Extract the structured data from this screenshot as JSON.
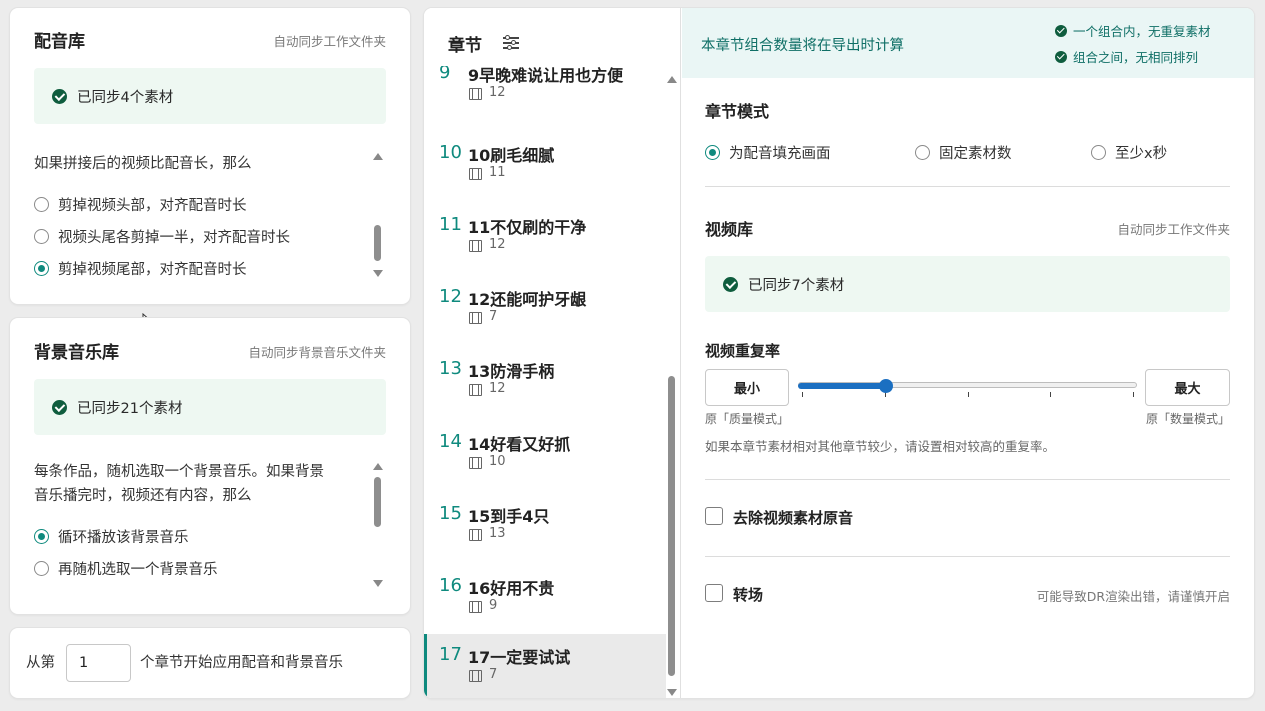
{
  "voice_lib": {
    "title": "配音库",
    "hint": "自动同步工作文件夹",
    "sync_status": "已同步4个素材",
    "question": "如果拼接后的视频比配音长，那么",
    "options": [
      {
        "label": "剪掉视频头部，对齐配音时长",
        "selected": false
      },
      {
        "label": "视频头尾各剪掉一半，对齐配音时长",
        "selected": false
      },
      {
        "label": "剪掉视频尾部，对齐配音时长",
        "selected": true
      }
    ]
  },
  "bgm_lib": {
    "title": "背景音乐库",
    "hint": "自动同步背景音乐文件夹",
    "sync_status": "已同步21个素材",
    "question_line1": "每条作品，随机选取一个背景音乐。如果背景",
    "question_line2": "音乐播完时，视频还有内容，那么",
    "options": [
      {
        "label": "循环播放该背景音乐",
        "selected": true
      },
      {
        "label": "再随机选取一个背景音乐",
        "selected": false
      }
    ]
  },
  "start_chapter": {
    "prefix": "从第",
    "value": "1",
    "suffix": "个章节开始应用配音和背景音乐"
  },
  "chapters": {
    "title": "章节",
    "partial_item": {
      "num": "9",
      "title": "9早晚难说让用也方便",
      "count": "12"
    },
    "items": [
      {
        "num": "10",
        "title": "10刷毛细腻",
        "count": "11"
      },
      {
        "num": "11",
        "title": "11不仅刷的干净",
        "count": "12"
      },
      {
        "num": "12",
        "title": "12还能呵护牙龈",
        "count": "7"
      },
      {
        "num": "13",
        "title": "13防滑手柄",
        "count": "12"
      },
      {
        "num": "14",
        "title": "14好看又好抓",
        "count": "10"
      },
      {
        "num": "15",
        "title": "15到手4只",
        "count": "13"
      },
      {
        "num": "16",
        "title": "16好用不贵",
        "count": "9"
      },
      {
        "num": "17",
        "title": "17一定要试试",
        "count": "7"
      }
    ],
    "selected_index": 7
  },
  "banner": {
    "text": "本章节组合数量将在导出时计算",
    "rule1": "一个组合内，无重复素材",
    "rule2": "组合之间，无相同排列"
  },
  "chapter_mode": {
    "title": "章节模式",
    "options": [
      {
        "label": "为配音填充画面",
        "selected": true
      },
      {
        "label": "固定素材数",
        "selected": false
      },
      {
        "label": "至少x秒",
        "selected": false
      }
    ]
  },
  "video_lib": {
    "title": "视频库",
    "hint": "自动同步工作文件夹",
    "sync_status": "已同步7个素材"
  },
  "repeat_rate": {
    "title": "视频重复率",
    "min_label": "最小",
    "max_label": "最大",
    "min_caption": "原「质量模式」",
    "max_caption": "原「数量模式」",
    "value_fraction": 0.26,
    "ticks": 5,
    "help": "如果本章节素材相对其他章节较少，请设置相对较高的重复率。"
  },
  "remove_audio": {
    "label": "去除视频素材原音",
    "checked": false
  },
  "transition": {
    "label": "转场",
    "checked": false,
    "warning": "可能导致DR渲染出错，请谨慎开启"
  },
  "colors": {
    "accent": "#0f8a7e",
    "slider": "#1b6fc1",
    "sync_bg": "#eef8f2",
    "banner_bg": "#eaf6f5",
    "check": "#0f5d3e"
  }
}
